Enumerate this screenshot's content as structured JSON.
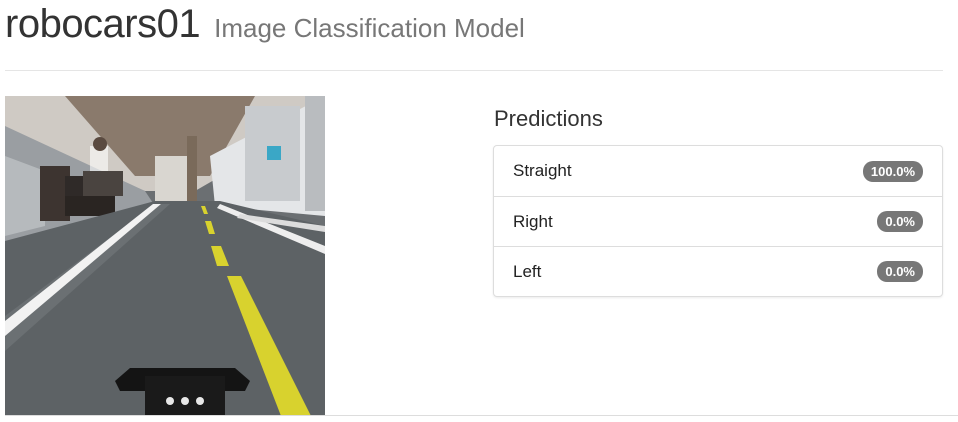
{
  "header": {
    "app_name": "robocars01",
    "subtitle": "Image Classification Model"
  },
  "camera_image": {
    "subject": "robot car front-camera view of an indoor track with yellow center dashes and white lane borders"
  },
  "predictions": {
    "title": "Predictions",
    "items": [
      {
        "label": "Straight",
        "value": "100.0%"
      },
      {
        "label": "Right",
        "value": "0.0%"
      },
      {
        "label": "Left",
        "value": "0.0%"
      }
    ]
  },
  "colors": {
    "badge": "#777777",
    "lane_yellow": "#d8d22e",
    "floor": "#5d6265"
  }
}
